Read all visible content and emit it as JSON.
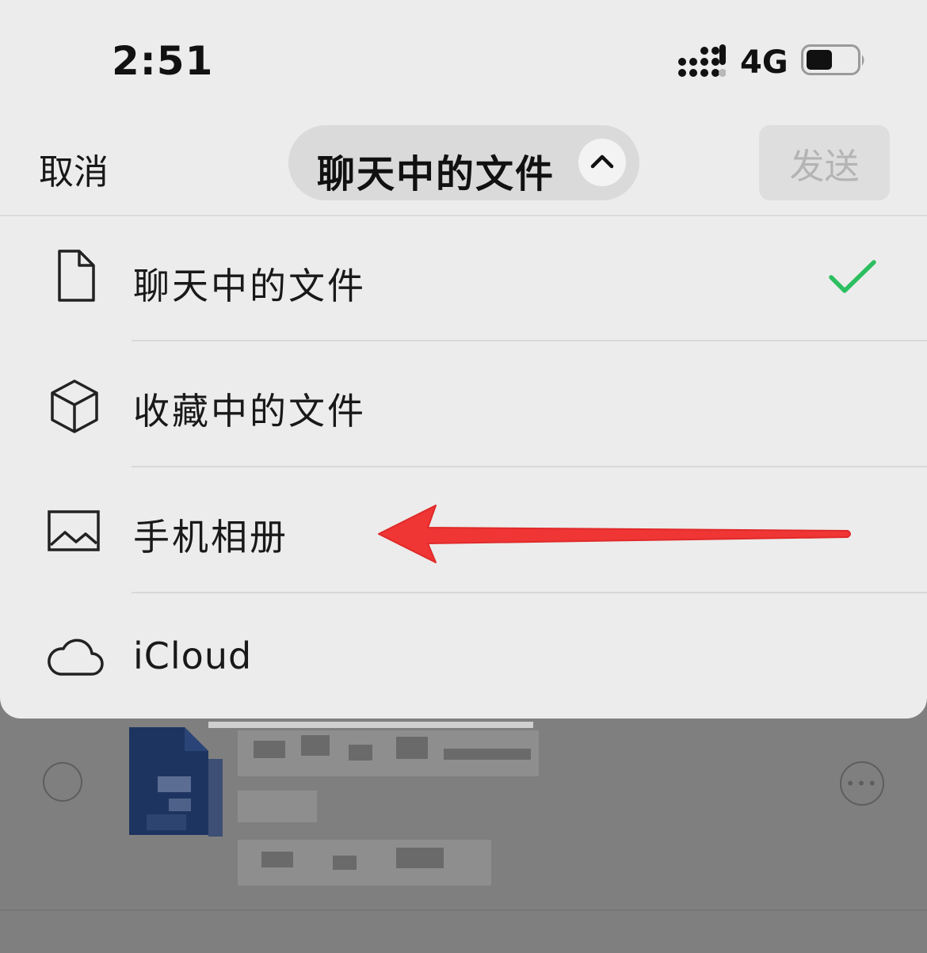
{
  "status_bar": {
    "time": "2:51",
    "network": "4G",
    "signal_icon": "signal-bars-icon",
    "battery_icon": "battery-icon"
  },
  "header": {
    "cancel_label": "取消",
    "selector_label": "聊天中的文件",
    "selector_icon": "chevron-up-icon",
    "send_label": "发送"
  },
  "menu": {
    "items": [
      {
        "label": "聊天中的文件",
        "icon": "document-icon",
        "selected": true
      },
      {
        "label": "收藏中的文件",
        "icon": "cube-icon",
        "selected": false
      },
      {
        "label": "手机相册",
        "icon": "image-icon",
        "selected": false
      },
      {
        "label": "iCloud",
        "icon": "cloud-icon",
        "selected": false
      }
    ],
    "selected_icon": "checkmark-icon"
  },
  "colors": {
    "sheet_bg": "#ececec",
    "overlay": "#7f7f7f",
    "check_green": "#2cbf5f",
    "arrow_red": "#f03535",
    "doc_blue": "#1e3460"
  },
  "background_list": {
    "row_icon": "word-document-icon",
    "more_icon": "more-options-icon",
    "radio_icon": "radio-unchecked-icon"
  }
}
